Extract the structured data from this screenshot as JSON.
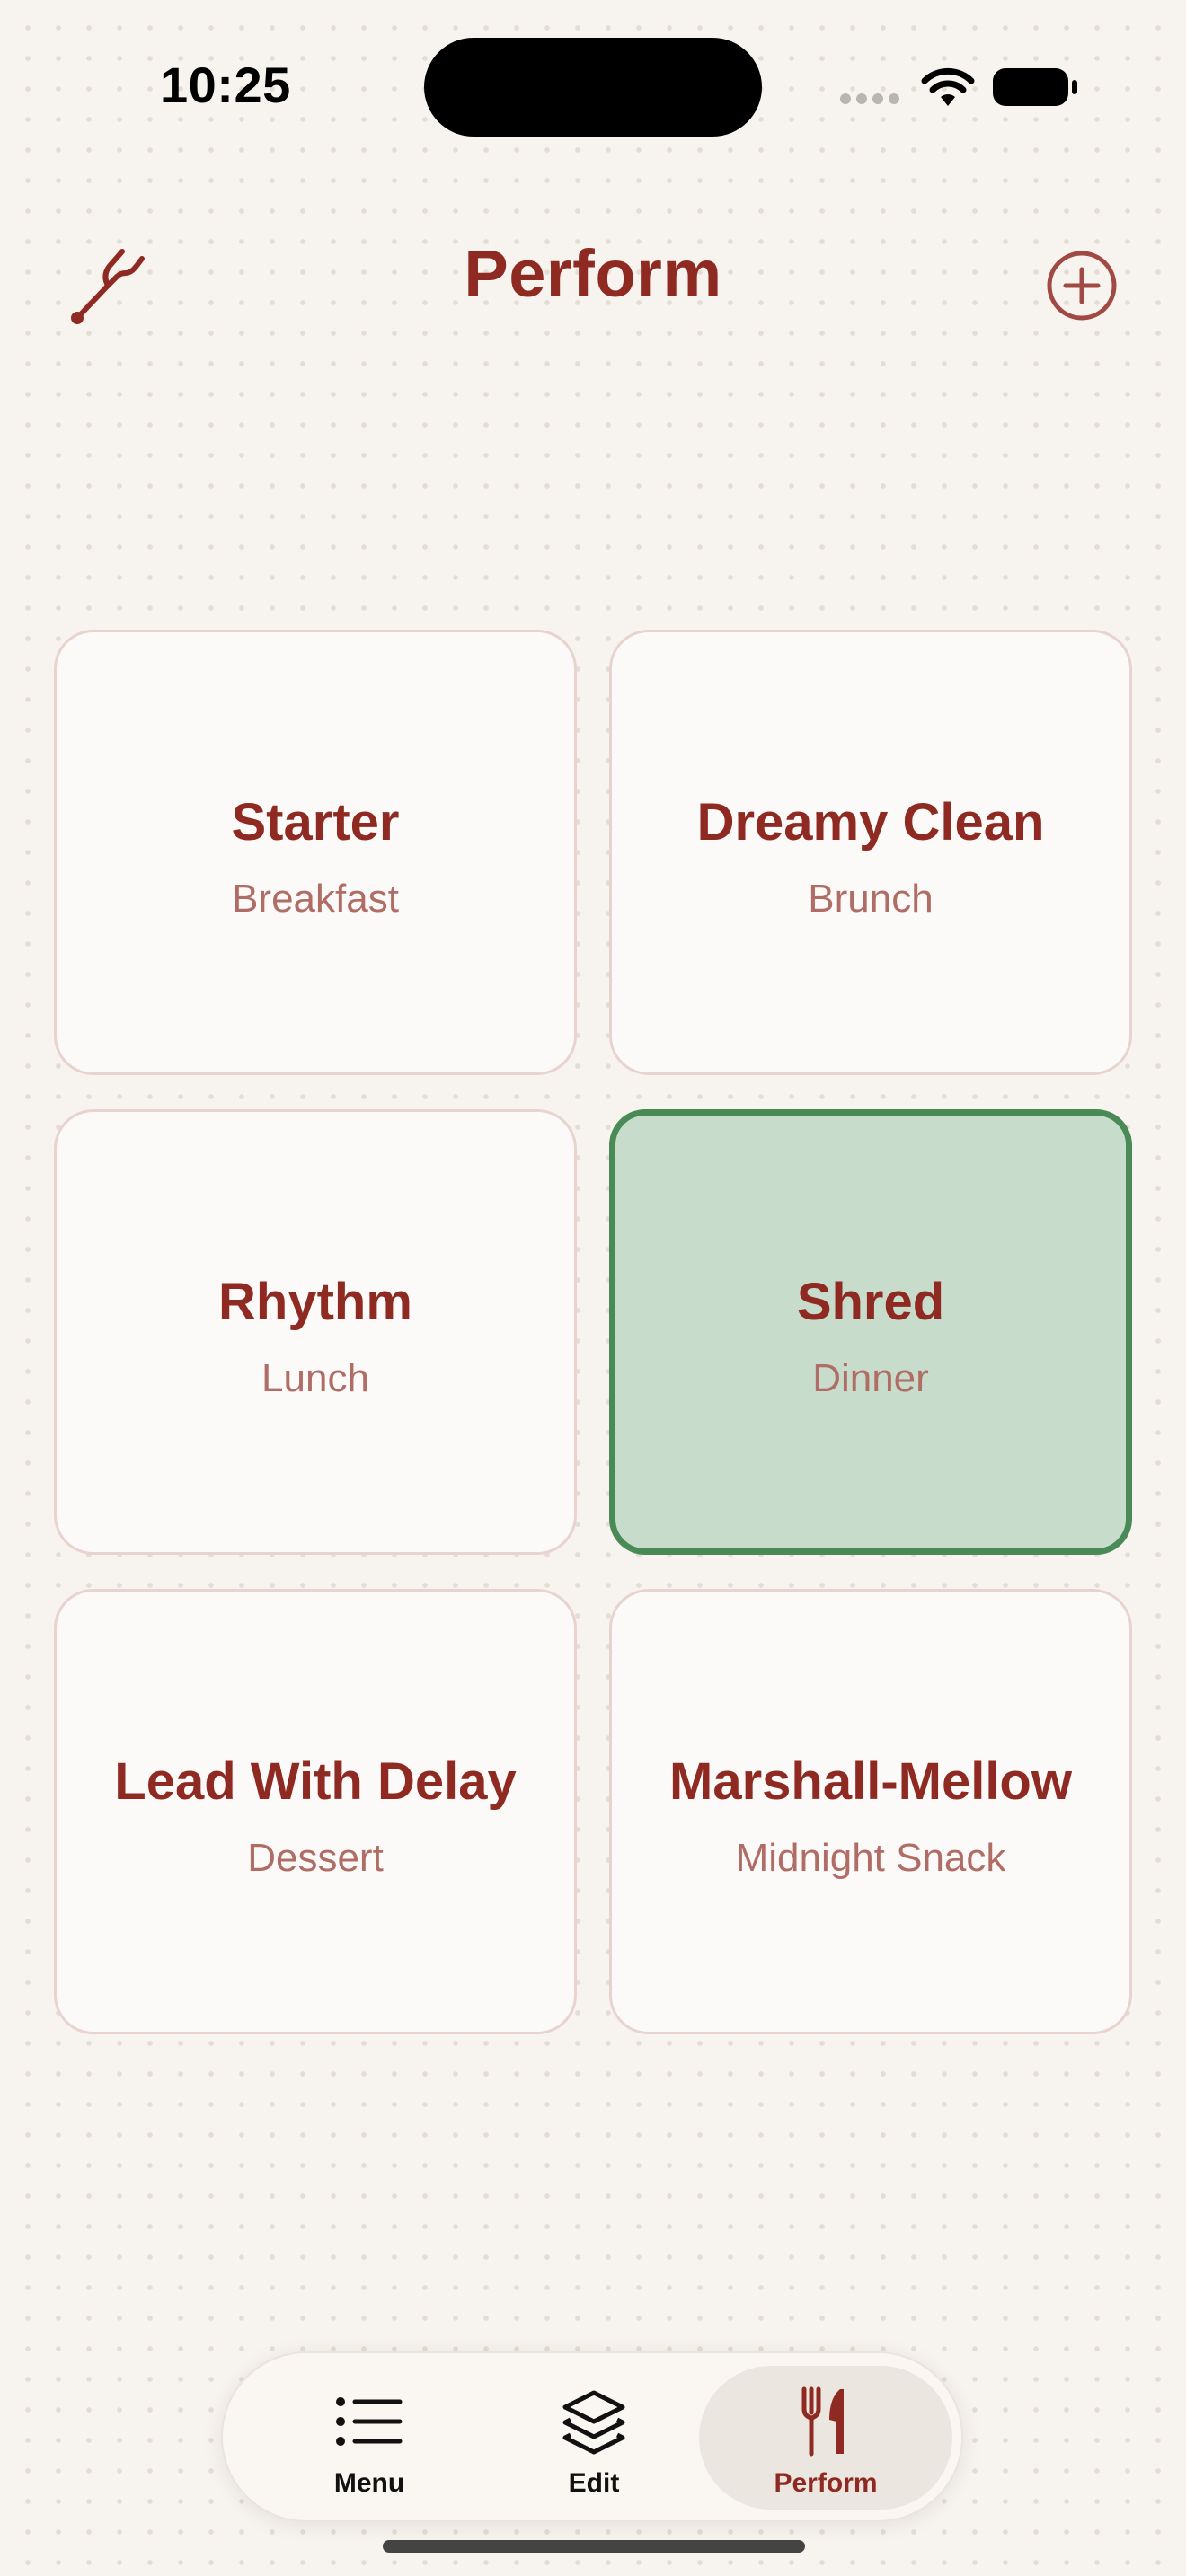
{
  "status_bar": {
    "time": "10:25"
  },
  "header": {
    "title": "Perform",
    "left_icon": "tuning-fork-icon",
    "right_icon": "plus-circle-icon"
  },
  "cards": [
    {
      "title": "Starter",
      "subtitle": "Breakfast",
      "selected": false
    },
    {
      "title": "Dreamy Clean",
      "subtitle": "Brunch",
      "selected": false
    },
    {
      "title": "Rhythm",
      "subtitle": "Lunch",
      "selected": false
    },
    {
      "title": "Shred",
      "subtitle": "Dinner",
      "selected": true
    },
    {
      "title": "Lead With Delay",
      "subtitle": "Dessert",
      "selected": false
    },
    {
      "title": "Marshall-Mellow",
      "subtitle": "Midnight Snack",
      "selected": false
    }
  ],
  "tabs": [
    {
      "label": "Menu",
      "icon": "list-icon",
      "active": false
    },
    {
      "label": "Edit",
      "icon": "layers-icon",
      "active": false
    },
    {
      "label": "Perform",
      "icon": "fork-knife-icon",
      "active": true
    }
  ],
  "colors": {
    "accent": "#8e2a22",
    "subtitle": "#b06d66",
    "selected_fill": "#c8dccb",
    "selected_border": "#4a8a57",
    "background": "#f7f3ee"
  }
}
